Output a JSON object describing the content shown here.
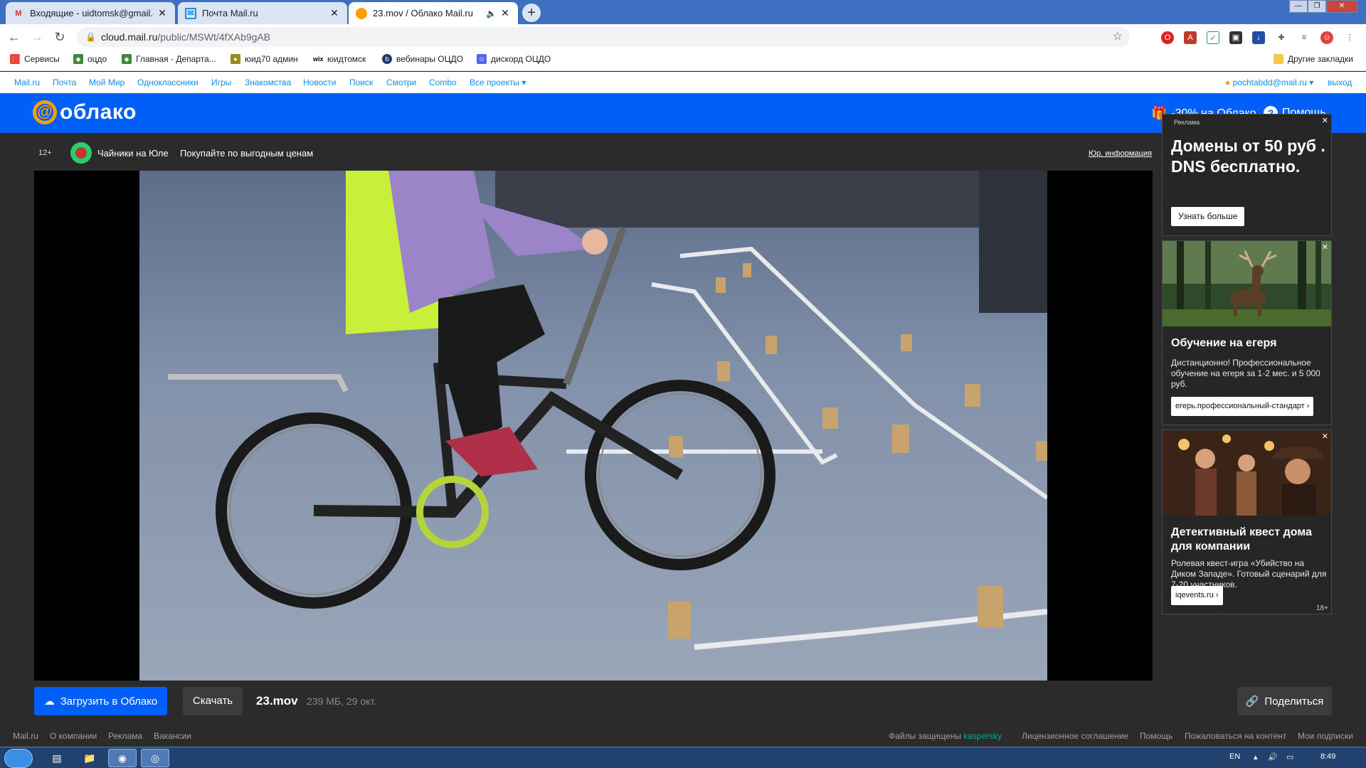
{
  "browser": {
    "tabs": [
      {
        "title": "Входящие - uidtomsk@gmail.com",
        "favicon": "gmail-icon"
      },
      {
        "title": "Почта Mail.ru",
        "favicon": "mailru-mail-icon"
      },
      {
        "title": "23.mov / Облако Mail.ru",
        "favicon": "mailru-cloud-icon"
      }
    ],
    "url_host": "cloud.mail.ru",
    "url_path": "/public/MSWt/4fXAb9gAB",
    "bookmarks": [
      {
        "label": "Сервисы",
        "icon": "apps-grid-icon"
      },
      {
        "label": "оцдо",
        "icon": "emblem-icon"
      },
      {
        "label": "Главная - Департа...",
        "icon": "emblem-icon"
      },
      {
        "label": "юид70 админ",
        "icon": "badge-icon"
      },
      {
        "label": "юидтомск",
        "icon": "wix-icon"
      },
      {
        "label": "вебинары ОЦДО",
        "icon": "webinar-icon"
      },
      {
        "label": "дискорд ОЦДО",
        "icon": "discord-icon"
      }
    ],
    "other_bookmarks": "Другие закладки"
  },
  "portal": {
    "links": [
      "Mail.ru",
      "Почта",
      "Мой Мир",
      "Одноклассники",
      "Игры",
      "Знакомства",
      "Новости",
      "Поиск",
      "Смотри",
      "Combo",
      "Все проекты"
    ],
    "user": "pochtabdd@mail.ru",
    "logout": "выход"
  },
  "cloud_header": {
    "logo_text": "облако",
    "promo": "-30% на Облако",
    "help": "Помощь"
  },
  "ad_line": {
    "age": "12+",
    "title": "Чайники на Юле",
    "text": "Покупайте по выгодным ценам",
    "legal": "Юр. информация"
  },
  "file": {
    "upload_label": "Загрузить в Облако",
    "download_label": "Скачать",
    "name": "23.mov",
    "meta": "239 МБ, 29 окт.",
    "share_label": "Поделиться"
  },
  "footer": {
    "left": [
      "Mail.ru",
      "О компании",
      "Реклама",
      "Вакансии"
    ],
    "protected_prefix": "Файлы защищены",
    "protected_brand": "kaspersky",
    "right": [
      "Лицензионное соглашение",
      "Помощь",
      "Пожаловаться на контент",
      "Мои подписки"
    ]
  },
  "ads": {
    "ad1": {
      "label": "Реклама",
      "title": "Домены от 50 руб . DNS бесплатно.",
      "button": "Узнать больше"
    },
    "ad2": {
      "title": "Обучение на егеря",
      "body": "Дистанционно! Профессиональное обучение на егеря за 1-2 мес. и 5 000 руб.",
      "button": "егерь.профессиональный-стандарт"
    },
    "ad3": {
      "title": "Детективный квест дома для компании",
      "body": "Ролевая квест-игра «Убийство на Диком Западе». Готовый сценарий для 7-20 участников.",
      "button": "iqevents.ru",
      "age": "18+"
    }
  },
  "taskbar": {
    "lang": "EN",
    "time": "8:49"
  }
}
